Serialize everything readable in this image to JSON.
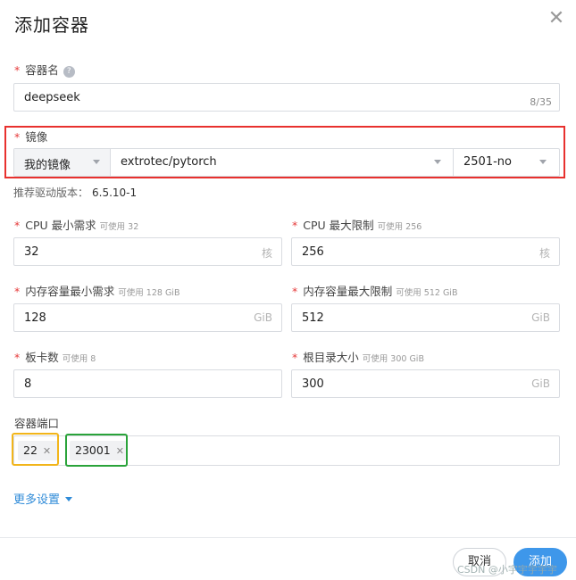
{
  "dialog": {
    "title": "添加容器",
    "close_symbol": "✕"
  },
  "name_field": {
    "label": "容器名",
    "value": "deepseek",
    "counter": "8/35"
  },
  "image_field": {
    "label": "镜像",
    "source": "我的镜像",
    "repository": "extrotec/pytorch",
    "tag": "2501-no"
  },
  "driver_hint": {
    "label": "推荐驱动版本：",
    "value": "6.5.10-1"
  },
  "cpu_min": {
    "label": "CPU 最小需求",
    "avail": "可使用 32",
    "value": "32",
    "unit": "核"
  },
  "cpu_max": {
    "label": "CPU 最大限制",
    "avail": "可使用 256",
    "value": "256",
    "unit": "核"
  },
  "mem_min": {
    "label": "内存容量最小需求",
    "avail": "可使用 128 GiB",
    "value": "128",
    "unit": "GiB"
  },
  "mem_max": {
    "label": "内存容量最大限制",
    "avail": "可使用 512 GiB",
    "value": "512",
    "unit": "GiB"
  },
  "cards": {
    "label": "板卡数",
    "avail": "可使用 8",
    "value": "8"
  },
  "root_dir": {
    "label": "根目录大小",
    "avail": "可使用 300 GiB",
    "value": "300",
    "unit": "GiB"
  },
  "ports": {
    "label": "容器端口",
    "tags": [
      "22",
      "23001"
    ],
    "remove_symbol": "✕"
  },
  "more_settings": "更多设置",
  "footer": {
    "cancel": "取消",
    "add": "添加",
    "watermark": "CSDN @小宇宇宇宇宇"
  },
  "colors": {
    "required": "#e63b3b",
    "link": "#2f8bd8",
    "primary": "#3e97ea",
    "highlight_red": "#e8312e",
    "highlight_yellow": "#f2b51a",
    "highlight_green": "#2aa33a"
  }
}
